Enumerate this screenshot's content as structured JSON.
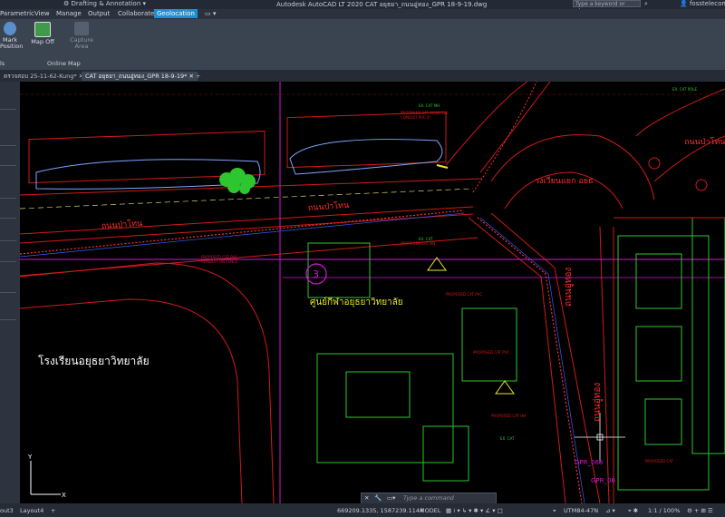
{
  "title_bar": {
    "workspace": "Drafting & Annotation",
    "title": "Autodesk AutoCAD LT 2020    CAT อยุธยา_ถนนอู่ทอง_GPR 18-9-19.dwg",
    "search_placeholder": "Type a keyword or phrase",
    "user": "fosstelecom-..."
  },
  "menu": {
    "items": [
      "Parametric",
      "View",
      "Manage",
      "Output",
      "Collaborate"
    ],
    "active": "Geolocation"
  },
  "ribbon": {
    "mark_position": "Mark\nPosition",
    "map_off": "Map Off",
    "capture_area": "Capture\nArea",
    "panel_left": "ls",
    "panel_online_map": "Online Map"
  },
  "tabs": {
    "tab1": "ตรวจสอบ 25-11-62-Kung*",
    "tab2": "CAT อยุธยา_ถนนอู่ทอง_GPR 18-9-19*"
  },
  "drawing": {
    "road_upper": "ถนนป่าโทน",
    "road_left": "ถนนป่าโทน",
    "road_right_top": "ถนนป่าโทน",
    "roundabout": "วงเวียนแยก อยธ",
    "sports_center": "ศูนย์กีฬาอยุธยาวิทยาลัย",
    "school": "โรงเรียนอยุธยาวิทยาลัย",
    "road_vertical_1": "ถนนอู่ทอง",
    "road_vertical_2": "ถนนอู่ทอง",
    "circle_num": "3",
    "gpr_1": "GPR_068",
    "gpr_2": "GPR_06"
  },
  "command": {
    "placeholder": "Type a command"
  },
  "status": {
    "layout_tab1": "out3",
    "layout_tab2": "Layout4",
    "coords": "669209.1335, 1587239.1144",
    "model": "MODEL",
    "utm": "UTM84-47N",
    "scale": "1:1 / 100%"
  },
  "colors": {
    "titlebar": "#232a35",
    "ribbon": "#3a4350",
    "accent": "#1f8fd1",
    "canvas": "#000000",
    "road_red": "#d11a1a",
    "magenta": "#d11ad1",
    "green": "#2ec62e",
    "yellow": "#e8e82a"
  }
}
